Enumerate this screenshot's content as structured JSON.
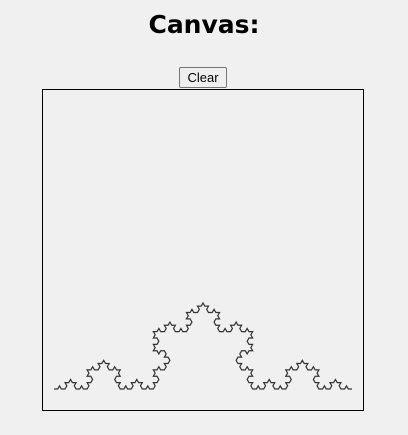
{
  "page": {
    "heading": "Canvas:"
  },
  "toolbar": {
    "clear_label": "Clear"
  },
  "drawing": {
    "shape": "koch-curve",
    "iterations": 4,
    "stroke_color": "#333333"
  }
}
